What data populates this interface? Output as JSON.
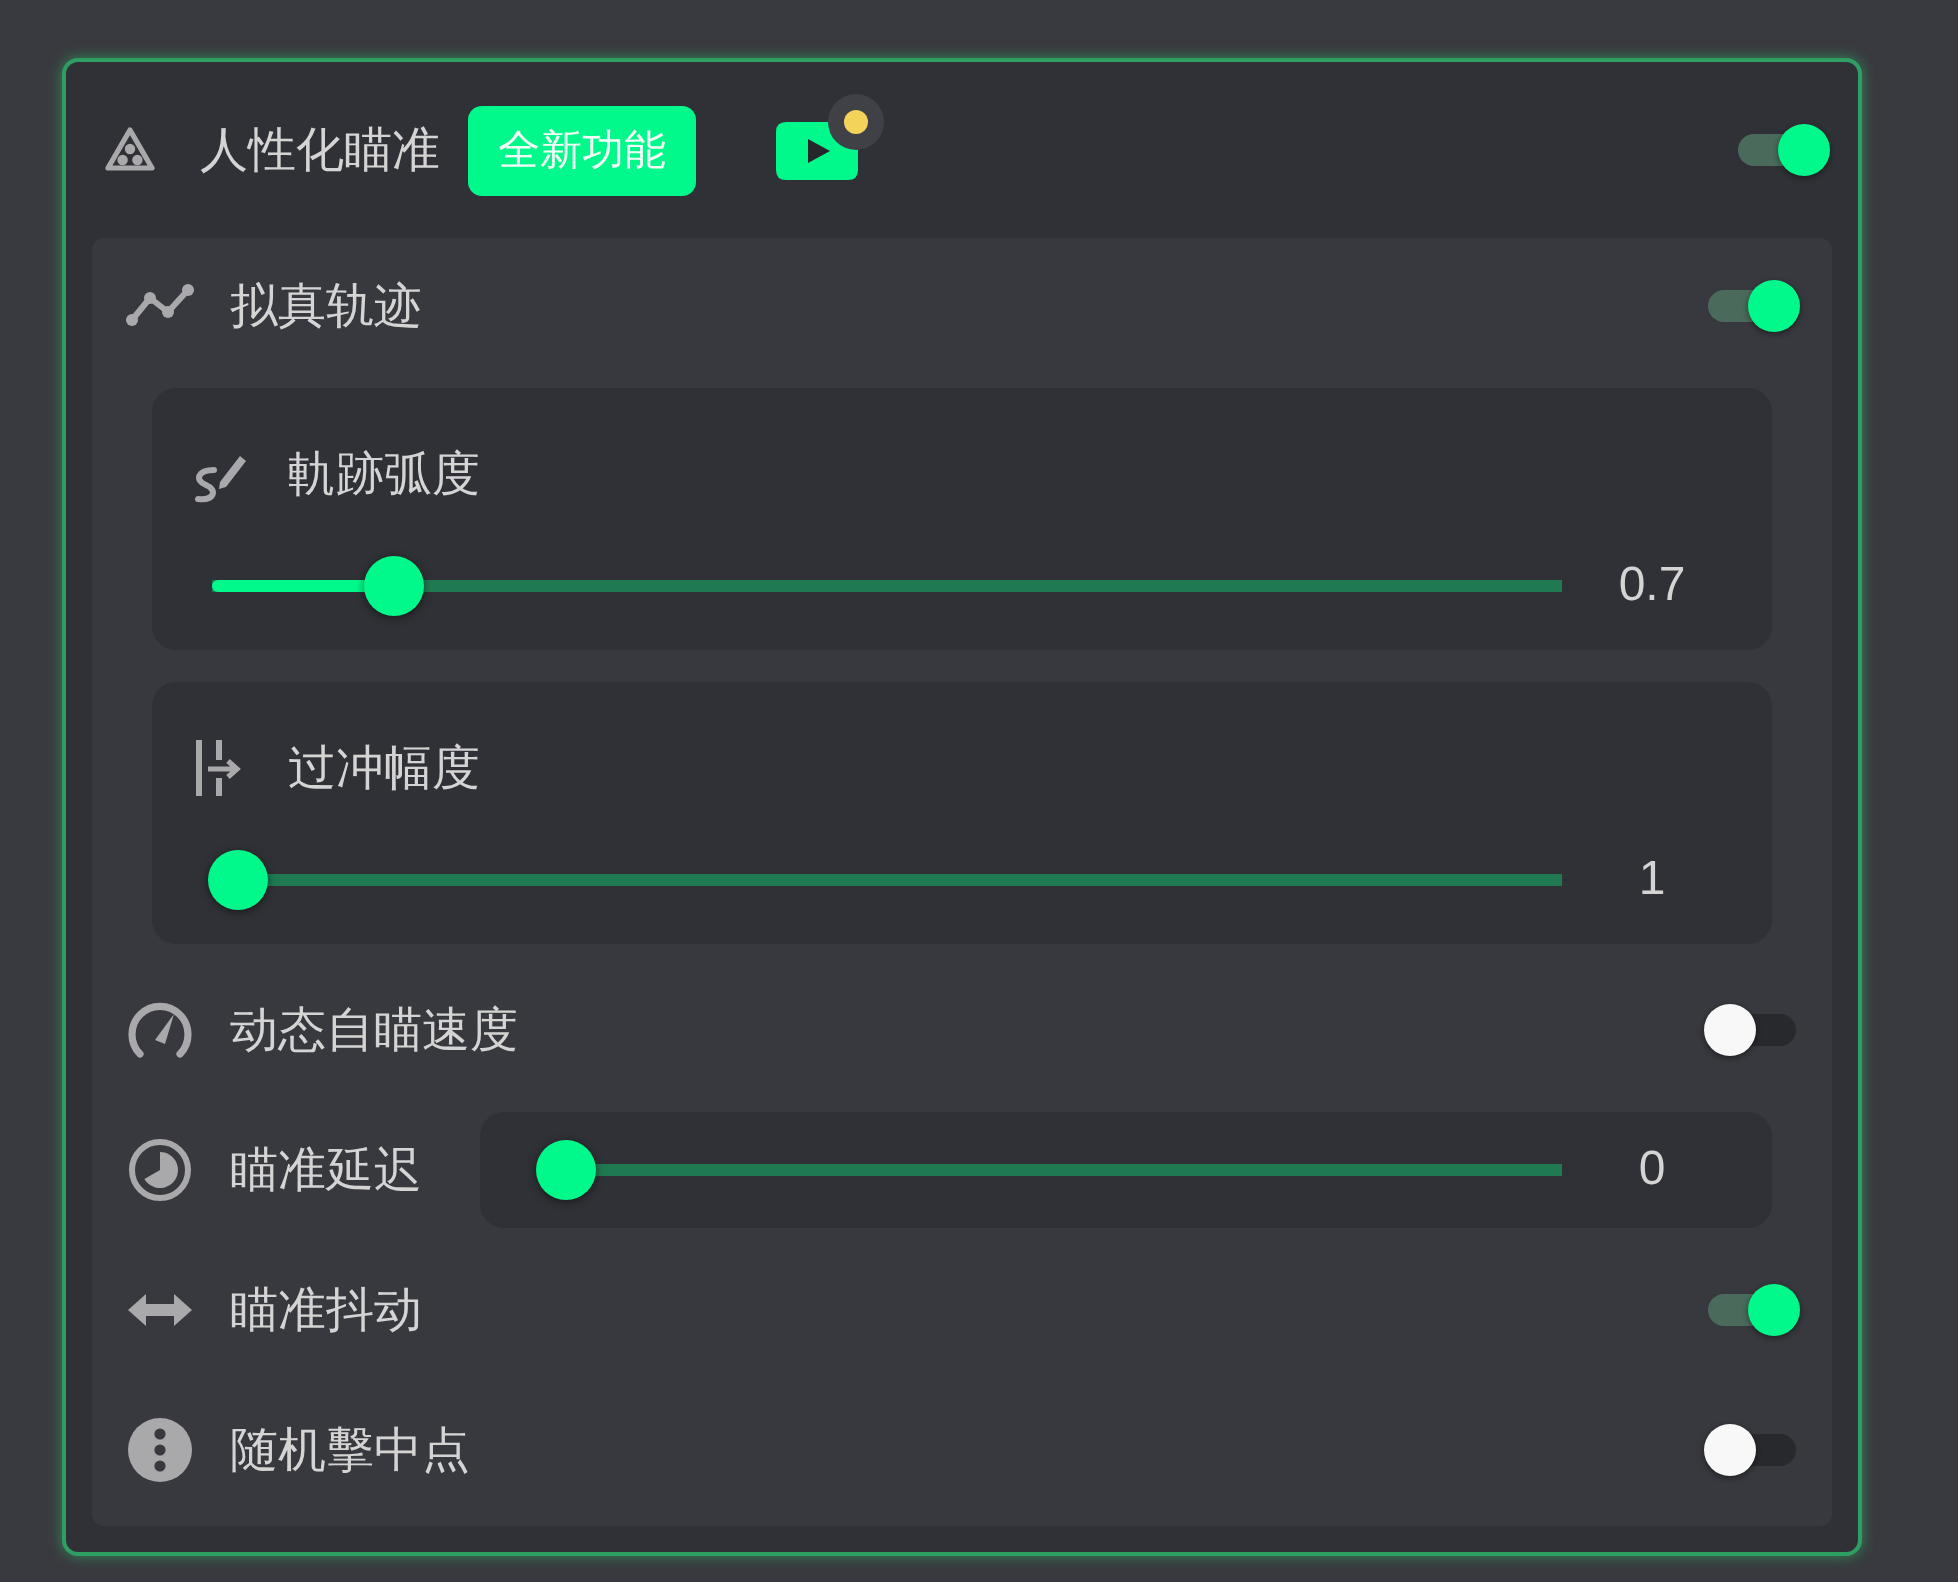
{
  "header": {
    "title": "人性化瞄准",
    "badge": "全新功能",
    "video": {
      "notification": true
    },
    "toggle": {
      "on": true
    }
  },
  "settings": [
    {
      "kind": "toggle",
      "label": "拟真轨迹",
      "on": true,
      "sub_settings": [
        {
          "kind": "slider",
          "label": "軌跡弧度",
          "level": 0.12,
          "reading": "0.7"
        },
        {
          "kind": "slider",
          "label": "过冲幅度",
          "level": 0,
          "reading": "1"
        }
      ]
    },
    {
      "kind": "toggle",
      "label": "动态自瞄速度",
      "on": false
    },
    {
      "kind": "slider",
      "label": "瞄准延迟",
      "level": 0,
      "reading": "0"
    },
    {
      "kind": "toggle",
      "label": "瞄准抖动",
      "on": true
    },
    {
      "kind": "toggle",
      "label": "随机擊中点",
      "on": false
    }
  ]
}
